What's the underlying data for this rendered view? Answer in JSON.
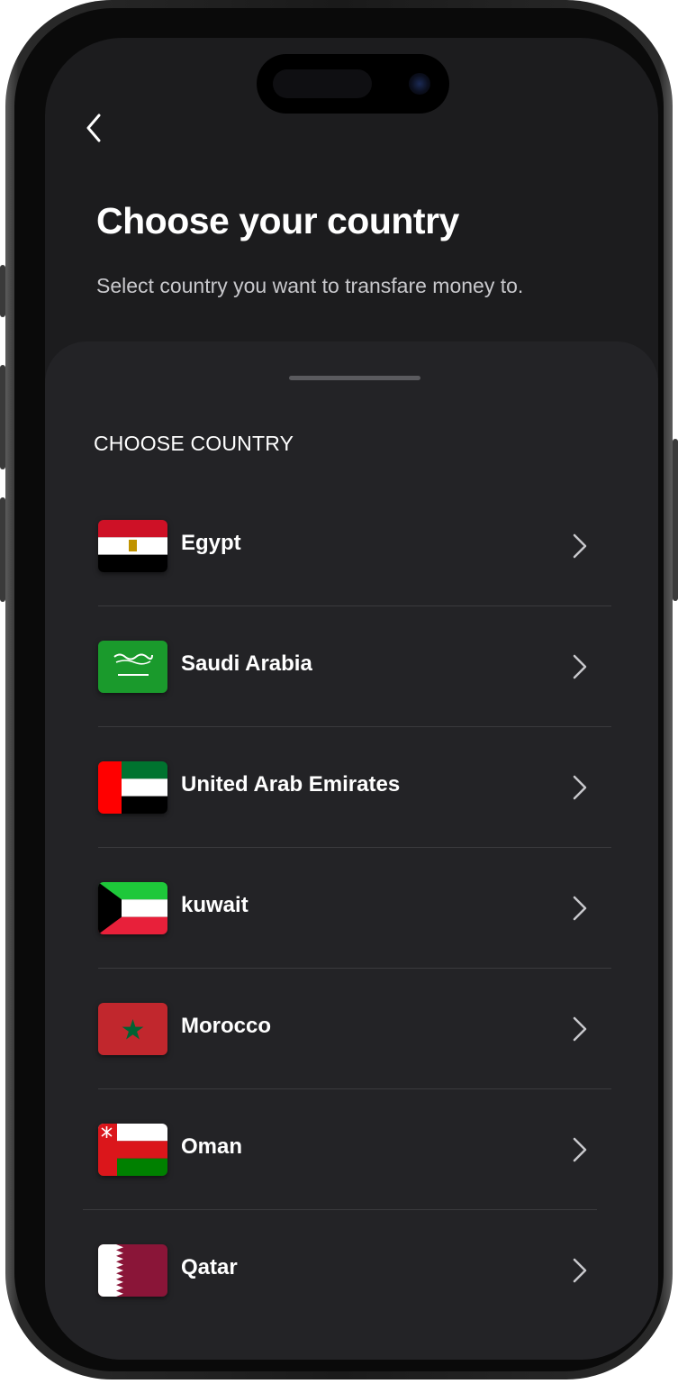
{
  "header": {
    "back_icon": "chevron-left-icon",
    "title": "Choose your country",
    "subtitle": "Select country you want to transfare money to."
  },
  "sheet": {
    "section_label": "CHOOSE COUNTRY",
    "countries": [
      {
        "name": "Egypt",
        "flag": "egypt-flag"
      },
      {
        "name": "Saudi Arabia",
        "flag": "saudi-arabia-flag"
      },
      {
        "name": "United Arab Emirates",
        "flag": "uae-flag"
      },
      {
        "name": "kuwait",
        "flag": "kuwait-flag"
      },
      {
        "name": "Morocco",
        "flag": "morocco-flag"
      },
      {
        "name": "Oman",
        "flag": "oman-flag"
      },
      {
        "name": "Qatar",
        "flag": "qatar-flag"
      }
    ]
  },
  "colors": {
    "background": "#1c1c1e",
    "sheet": "#232326",
    "text": "#ffffff",
    "secondary_text": "#c8c8cc"
  }
}
